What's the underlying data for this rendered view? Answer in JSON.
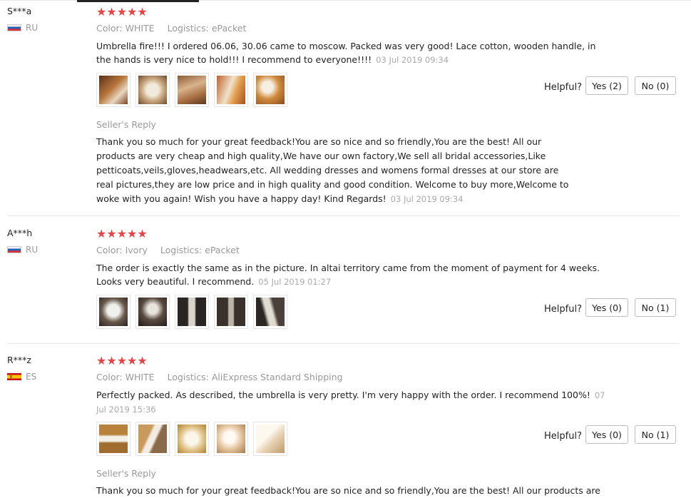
{
  "reviews": [
    {
      "user": "S***a",
      "country": "RU",
      "stars": "★★★★★",
      "color": "Color: WHITE",
      "logistics": "Logistics: ePacket",
      "text": "Umbrella fire!!! I ordered 06.06, 30.06 came to moscow. Packed was very good! Lace cotton, wooden handle, in the hands is very nice to hold!!! I recommend to everyone!!!!",
      "date": "03 Jul 2019 09:34",
      "helpful_label": "Helpful?",
      "yes_label": "Yes (2)",
      "no_label": "No (0)",
      "seller_reply_title": "Seller's Reply",
      "seller_reply": "Thank you so much for your great feedback!You are so nice and so friendly,You are the best! All our products are very cheap and high quality,We have our own factory,We sell all bridal accessories,Like petticoats,veils,gloves,headwears,etc. All wedding dresses and womens formal dresses at our store are real pictures,they are low price and in high quality and good condition. Welcome to buy more,Welcome to woke with you again! Wish you have a happy day! Kind Regards!",
      "seller_reply_date": "03 Jul 2019 09:34"
    },
    {
      "user": "A***h",
      "country": "RU",
      "stars": "★★★★★",
      "color": "Color: Ivory",
      "logistics": "Logistics: ePacket",
      "text": "The order is exactly the same as in the picture. In altai territory came from the moment of payment for 4 weeks. Looks very beautiful. I recommend.",
      "date": "05 Jul 2019 01:27",
      "helpful_label": "Helpful?",
      "yes_label": "Yes (0)",
      "no_label": "No (1)"
    },
    {
      "user": "R***z",
      "country": "ES",
      "stars": "★★★★★",
      "color": "Color: WHITE",
      "logistics": "Logistics: AliExpress Standard Shipping",
      "text": "Perfectly packed. As described, the umbrella is very pretty. I'm very happy with the order. I recommend 100%!",
      "date": "07 Jul 2019 15:36",
      "helpful_label": "Helpful?",
      "yes_label": "Yes (0)",
      "no_label": "No (1)",
      "seller_reply_title": "Seller's Reply",
      "seller_reply": "Thank you so much for your great feedback!You are so nice and so friendly,You are the best! All our products are"
    }
  ],
  "colors": {
    "star": "#e64545",
    "meta_gray": "#999999",
    "date_gray": "#aaaaaa",
    "button_border": "#bdbdbd"
  }
}
